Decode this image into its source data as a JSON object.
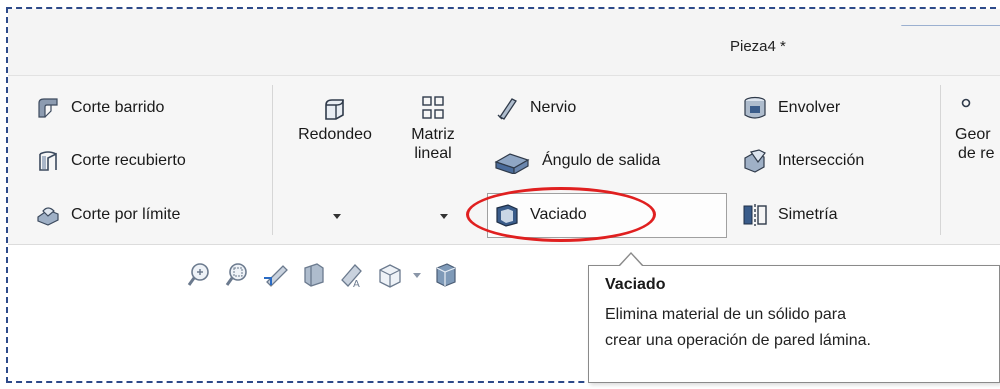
{
  "window": {
    "title": "Pieza4 *"
  },
  "ribbon": {
    "cut_group": [
      {
        "label": "Corte barrido",
        "icon": "swept-cut-icon"
      },
      {
        "label": "Corte recubierto",
        "icon": "lofted-cut-icon"
      },
      {
        "label": "Corte por límite",
        "icon": "boundary-cut-icon"
      }
    ],
    "fillet": {
      "label": "Redondeo",
      "icon": "fillet-icon"
    },
    "linear_pattern": {
      "label_line1": "Matriz",
      "label_line2": "lineal",
      "icon": "linear-pattern-icon"
    },
    "features_col1": [
      {
        "label": "Nervio",
        "icon": "rib-icon"
      },
      {
        "label": "Ángulo de salida",
        "icon": "draft-icon"
      },
      {
        "label": "Vaciado",
        "icon": "shell-icon"
      }
    ],
    "features_col2": [
      {
        "label": "Envolver",
        "icon": "wrap-icon"
      },
      {
        "label": "Intersección",
        "icon": "intersect-icon"
      },
      {
        "label": "Simetría",
        "icon": "mirror-icon"
      }
    ],
    "reference_geometry": {
      "label_line1": "Geor",
      "label_line2": "de re"
    }
  },
  "tooltip": {
    "title": "Vaciado",
    "line1": "Elimina material de un sólido para",
    "line2": "crear una operación de pared lámina."
  },
  "colors": {
    "highlight_ellipse": "#e02020",
    "frame_dash": "#2d4a8a"
  }
}
